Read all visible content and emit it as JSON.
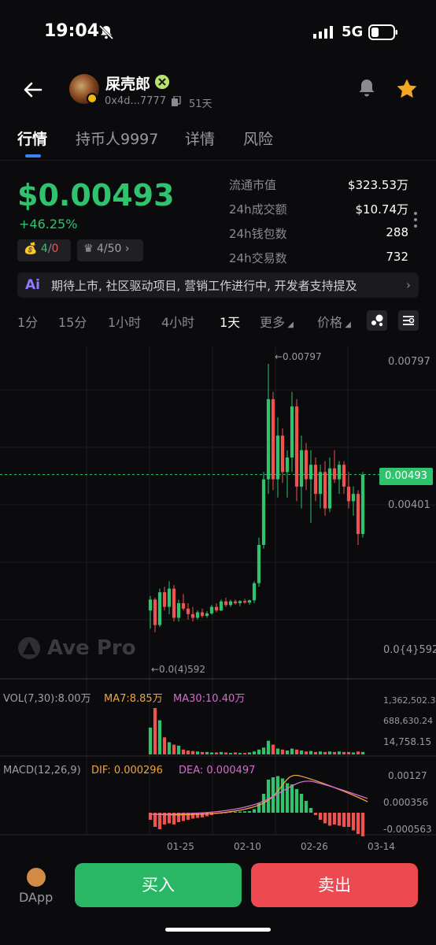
{
  "status": {
    "time": "19:04",
    "network": "5G"
  },
  "header": {
    "name": "屎壳郎",
    "address": "0x4d...7777",
    "age": "51天"
  },
  "tabs": [
    "行情",
    "持币人9997",
    "详情",
    "风险"
  ],
  "price": {
    "value": "$0.00493",
    "change": "+46.25%"
  },
  "pills": {
    "snipers_a": "4",
    "snipers_b": "0",
    "dev": "4/50"
  },
  "stats": [
    {
      "label": "流通市值",
      "value": "$323.53万"
    },
    {
      "label": "24h成交额",
      "value": "$10.74万"
    },
    {
      "label": "24h钱包数",
      "value": "288"
    },
    {
      "label": "24h交易数",
      "value": "732"
    }
  ],
  "ai_summary": "期待上市, 社区驱动项目, 营销工作进行中, 开发者支持提及",
  "intervals": [
    "1分",
    "15分",
    "1小时",
    "4小时",
    "1天",
    "更多",
    "价格"
  ],
  "active_interval": "1天",
  "chart": {
    "watermark": "Ave Pro",
    "price_axis": [
      "0.00797",
      "0.00401",
      "0.0{4}592"
    ],
    "current_price_tag": "0.00493",
    "high_label": "←0.00797",
    "low_label": "←0.0(4)592",
    "vol_label": "VOL(7,30):8.00万",
    "ma7_label": "MA7:8.85万",
    "ma30_label": "MA30:10.40万",
    "vol_axis": [
      "1,362,502.34",
      "688,630.24",
      "14,758.15"
    ],
    "macd_label": "MACD(12,26,9)",
    "dif_label": "DIF: 0.000296",
    "dea_label": "DEA: 0.000497",
    "macd_axis": [
      "0.00127",
      "0.000356",
      "-0.000563"
    ],
    "dates": [
      "01-25",
      "02-10",
      "02-26",
      "03-14"
    ],
    "colors": {
      "up": "#2fc36e",
      "down": "#ef5350",
      "ma7": "#f0a43c",
      "ma30": "#d66bd0"
    }
  },
  "bottom": {
    "dapp": "DApp",
    "buy": "买入",
    "sell": "卖出"
  },
  "chart_data": {
    "type": "candlestick",
    "candles": [
      {
        "o": 0.0012,
        "h": 0.0016,
        "l": 0.0007,
        "c": 0.0015
      },
      {
        "o": 0.0015,
        "h": 0.00155,
        "l": 0.0006,
        "c": 0.0008
      },
      {
        "o": 0.0008,
        "h": 0.0018,
        "l": 0.00075,
        "c": 0.0017
      },
      {
        "o": 0.0017,
        "h": 0.00185,
        "l": 0.0012,
        "c": 0.0013
      },
      {
        "o": 0.0013,
        "h": 0.002,
        "l": 0.0011,
        "c": 0.0018
      },
      {
        "o": 0.0018,
        "h": 0.0019,
        "l": 0.0009,
        "c": 0.001
      },
      {
        "o": 0.001,
        "h": 0.0015,
        "l": 0.0009,
        "c": 0.0014
      },
      {
        "o": 0.0014,
        "h": 0.00165,
        "l": 0.0012,
        "c": 0.00125
      },
      {
        "o": 0.00125,
        "h": 0.0014,
        "l": 0.00095,
        "c": 0.0011
      },
      {
        "o": 0.0011,
        "h": 0.0013,
        "l": 0.0009,
        "c": 0.001
      },
      {
        "o": 0.001,
        "h": 0.0012,
        "l": 0.00095,
        "c": 0.00115
      },
      {
        "o": 0.00115,
        "h": 0.00125,
        "l": 0.001,
        "c": 0.00105
      },
      {
        "o": 0.00105,
        "h": 0.00118,
        "l": 0.001,
        "c": 0.00112
      },
      {
        "o": 0.00112,
        "h": 0.00135,
        "l": 0.00108,
        "c": 0.0013
      },
      {
        "o": 0.0013,
        "h": 0.0014,
        "l": 0.00115,
        "c": 0.0012
      },
      {
        "o": 0.0012,
        "h": 0.0015,
        "l": 0.00118,
        "c": 0.00145
      },
      {
        "o": 0.00145,
        "h": 0.00155,
        "l": 0.0013,
        "c": 0.00135
      },
      {
        "o": 0.00135,
        "h": 0.0015,
        "l": 0.0013,
        "c": 0.00145
      },
      {
        "o": 0.00145,
        "h": 0.0015,
        "l": 0.00135,
        "c": 0.0014
      },
      {
        "o": 0.0014,
        "h": 0.00148,
        "l": 0.00132,
        "c": 0.00146
      },
      {
        "o": 0.00146,
        "h": 0.00152,
        "l": 0.00138,
        "c": 0.00142
      },
      {
        "o": 0.00142,
        "h": 0.0015,
        "l": 0.00136,
        "c": 0.00148
      },
      {
        "o": 0.00148,
        "h": 0.002,
        "l": 0.0014,
        "c": 0.00195
      },
      {
        "o": 0.00195,
        "h": 0.0032,
        "l": 0.00185,
        "c": 0.003
      },
      {
        "o": 0.003,
        "h": 0.005,
        "l": 0.0029,
        "c": 0.0048
      },
      {
        "o": 0.0048,
        "h": 0.00797,
        "l": 0.0044,
        "c": 0.007
      },
      {
        "o": 0.007,
        "h": 0.0072,
        "l": 0.0045,
        "c": 0.0048
      },
      {
        "o": 0.0048,
        "h": 0.0065,
        "l": 0.0043,
        "c": 0.006
      },
      {
        "o": 0.006,
        "h": 0.0062,
        "l": 0.0047,
        "c": 0.005
      },
      {
        "o": 0.005,
        "h": 0.0056,
        "l": 0.0043,
        "c": 0.0054
      },
      {
        "o": 0.0054,
        "h": 0.0072,
        "l": 0.005,
        "c": 0.0068
      },
      {
        "o": 0.0068,
        "h": 0.007,
        "l": 0.0042,
        "c": 0.0046
      },
      {
        "o": 0.0046,
        "h": 0.006,
        "l": 0.004,
        "c": 0.0056
      },
      {
        "o": 0.0056,
        "h": 0.0058,
        "l": 0.0045,
        "c": 0.0048
      },
      {
        "o": 0.0048,
        "h": 0.0056,
        "l": 0.0036,
        "c": 0.0052
      },
      {
        "o": 0.0052,
        "h": 0.0054,
        "l": 0.0042,
        "c": 0.0044
      },
      {
        "o": 0.0044,
        "h": 0.0052,
        "l": 0.004,
        "c": 0.005
      },
      {
        "o": 0.005,
        "h": 0.0053,
        "l": 0.0038,
        "c": 0.004
      },
      {
        "o": 0.004,
        "h": 0.0054,
        "l": 0.0039,
        "c": 0.0051
      },
      {
        "o": 0.0051,
        "h": 0.0056,
        "l": 0.0047,
        "c": 0.0048
      },
      {
        "o": 0.0048,
        "h": 0.0053,
        "l": 0.0044,
        "c": 0.0052
      },
      {
        "o": 0.0052,
        "h": 0.0053,
        "l": 0.0044,
        "c": 0.0046
      },
      {
        "o": 0.0046,
        "h": 0.005,
        "l": 0.004,
        "c": 0.0042
      },
      {
        "o": 0.0042,
        "h": 0.0046,
        "l": 0.0038,
        "c": 0.0044
      },
      {
        "o": 0.0044,
        "h": 0.0045,
        "l": 0.003,
        "c": 0.0033
      },
      {
        "o": 0.0033,
        "h": 0.005,
        "l": 0.0032,
        "c": 0.00493
      }
    ],
    "volume_relative": [
      0.55,
      0.95,
      0.7,
      0.35,
      0.25,
      0.2,
      0.18,
      0.1,
      0.08,
      0.07,
      0.06,
      0.05,
      0.05,
      0.04,
      0.04,
      0.05,
      0.04,
      0.03,
      0.04,
      0.03,
      0.03,
      0.04,
      0.06,
      0.1,
      0.14,
      0.28,
      0.2,
      0.12,
      0.1,
      0.08,
      0.12,
      0.1,
      0.08,
      0.06,
      0.07,
      0.05,
      0.06,
      0.05,
      0.06,
      0.05,
      0.06,
      0.05,
      0.05,
      0.04,
      0.06,
      0.05
    ],
    "ylim": [
      5.92e-05,
      0.00797
    ]
  }
}
